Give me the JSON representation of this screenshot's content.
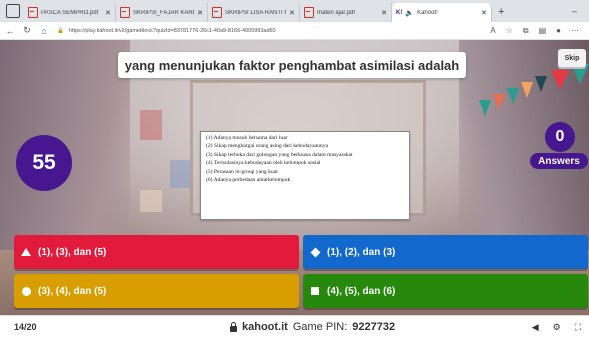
{
  "browser": {
    "tabs": [
      {
        "icon": "pdf-icon",
        "label": "PASCA SEMPRO.pdf",
        "active": false
      },
      {
        "icon": "pdf-icon",
        "label": "SKRIPSI_FAJAR KARENA SAL",
        "active": false
      },
      {
        "icon": "pdf-icon",
        "label": "SKRIPSI LISA RANTI MARDIN",
        "active": false
      },
      {
        "icon": "pdf-icon",
        "label": "materi ajar.pdf",
        "active": false
      },
      {
        "icon": "kahoot-favicon",
        "label": "Kahoot!",
        "active": true
      }
    ],
    "new_tab": "+",
    "minimize": "–",
    "url": "https://play.kahoot.it/v2/gameblock?quizId=83781776-26c1-40a9-8166-4009993ad60"
  },
  "game": {
    "question": "yang menunjukan faktor penghambat asimilasi adalah",
    "skip_label": "Skip",
    "timer": "55",
    "answers_count": "0",
    "answers_label": "Answers",
    "statements": [
      "(1)  Adanya musuh bersama dari luar",
      "(2)  Sikap menghargai orang asing dari kebudayaannya",
      "(3)  Sikap terbuka dari golongan yang berkuasa dalam masyarakat",
      "(4)  Terisolasinya kebudayaan oleh kelompok sosial",
      "(5)  Perasaan in-group yang kuat",
      "(6)  Adanya perbedaan antarkelompok"
    ],
    "choices": [
      {
        "shape": "triangle-icon",
        "label": "(1), (3), dan (5)",
        "color": "#e21b3c"
      },
      {
        "shape": "diamond-icon",
        "label": "(1), (2), dan (3)",
        "color": "#1368ce"
      },
      {
        "shape": "circle-icon",
        "label": "(3), (4), dan (5)",
        "color": "#d89e00"
      },
      {
        "shape": "square-icon",
        "label": "(4), (5), dan (6)",
        "color": "#26890c"
      }
    ]
  },
  "footer": {
    "progress": "14/20",
    "brand": "kahoot.it",
    "pin_label": "Game PIN:",
    "pin": "9227732"
  }
}
